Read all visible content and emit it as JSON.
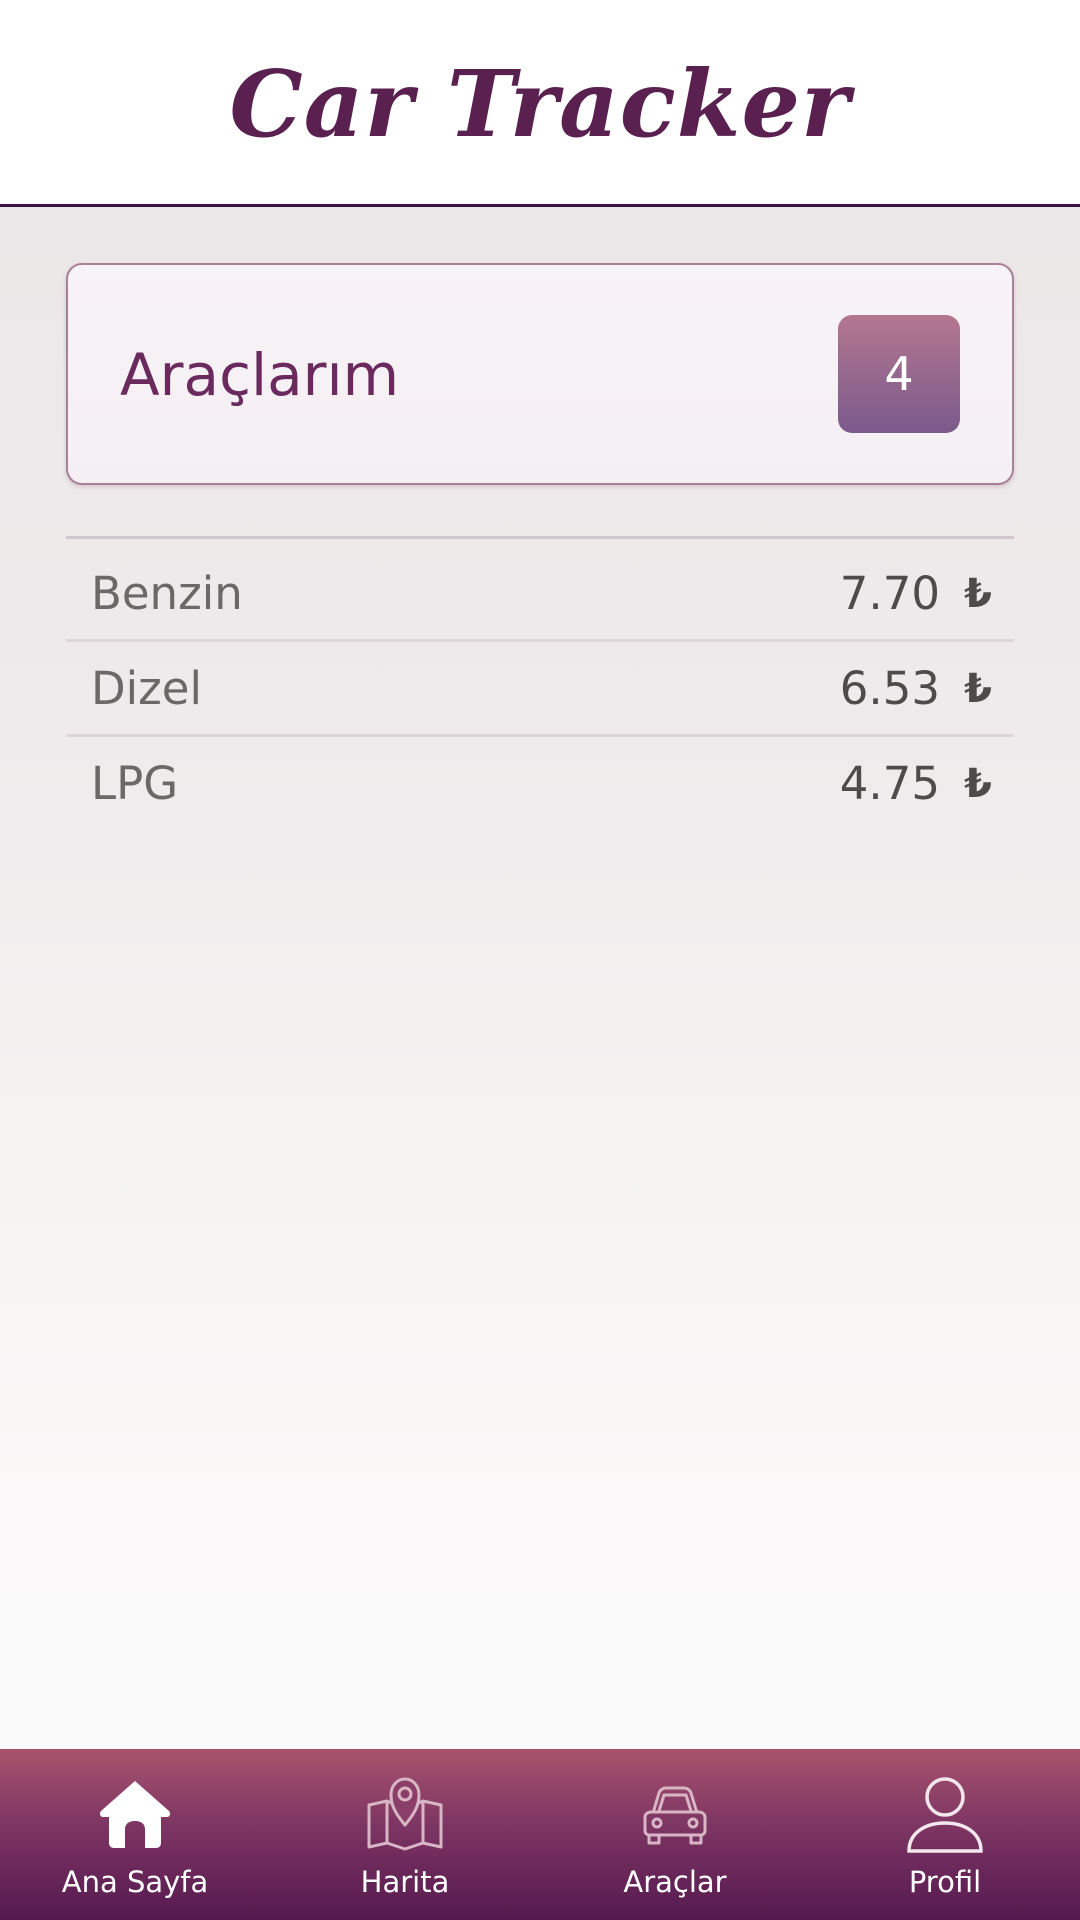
{
  "header": {
    "title": "Car Tracker"
  },
  "vehicles_card": {
    "label": "Araçlarım",
    "count": "4"
  },
  "fuel_prices": [
    {
      "name": "Benzin",
      "price": "7.70",
      "currency": "₺"
    },
    {
      "name": "Dizel",
      "price": "6.53",
      "currency": "₺"
    },
    {
      "name": "LPG",
      "price": "4.75",
      "currency": "₺"
    }
  ],
  "bottom_nav": {
    "items": [
      {
        "label": "Ana Sayfa",
        "icon": "home-icon",
        "active": true
      },
      {
        "label": "Harita",
        "icon": "map-icon",
        "active": false
      },
      {
        "label": "Araçlar",
        "icon": "car-icon",
        "active": false
      },
      {
        "label": "Profil",
        "icon": "user-icon",
        "active": false
      }
    ]
  },
  "colors": {
    "brand": "#5a2150",
    "accent": "#a8546c",
    "nav_dark": "#55194f"
  }
}
